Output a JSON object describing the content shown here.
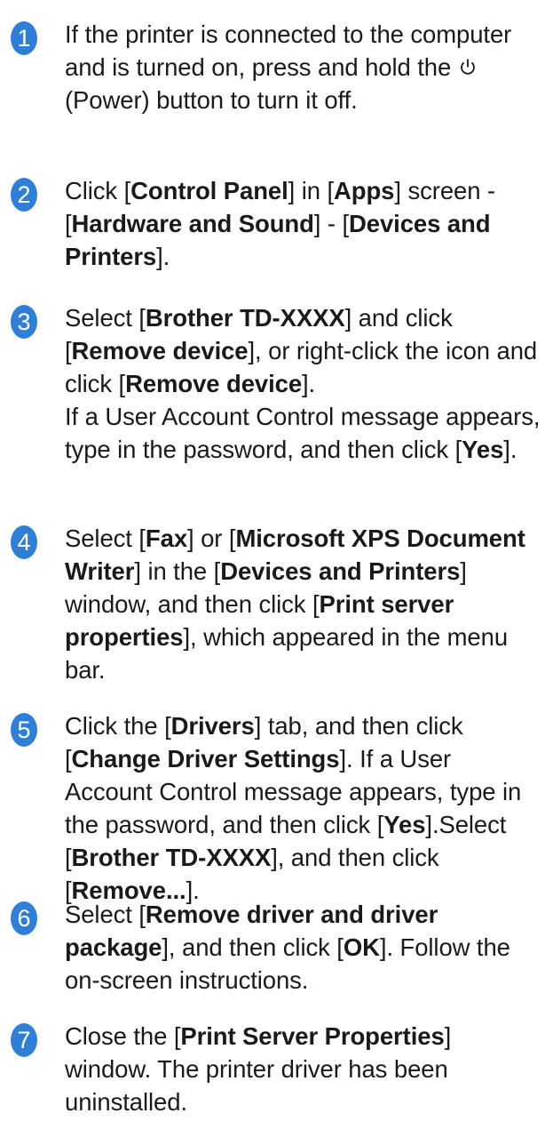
{
  "steps": [
    {
      "number": "1",
      "parts": [
        {
          "t": "If the printer is connected to the computer and is turned on, press and hold the "
        },
        {
          "icon": "power-icon"
        },
        {
          "t": " (Power) button to turn it off."
        }
      ]
    },
    {
      "number": "2",
      "parts": [
        {
          "t": "Click ["
        },
        {
          "b": "Control Panel"
        },
        {
          "t": "] in ["
        },
        {
          "b": "Apps"
        },
        {
          "t": "] screen - ["
        },
        {
          "b": "Hardware and Sound"
        },
        {
          "t": "] - ["
        },
        {
          "b": "Devices and Printers"
        },
        {
          "t": "]."
        }
      ]
    },
    {
      "number": "3",
      "parts": [
        {
          "t": "Select ["
        },
        {
          "b": "Brother TD-XXXX"
        },
        {
          "t": "] and click ["
        },
        {
          "b": "Remove device"
        },
        {
          "t": "], or right-click the icon and click ["
        },
        {
          "b": "Remove device"
        },
        {
          "t": "]."
        },
        {
          "br": true
        },
        {
          "t": "If a User Account Control message appears, type in the password, and then click ["
        },
        {
          "b": "Yes"
        },
        {
          "t": "]."
        }
      ]
    },
    {
      "number": "4",
      "parts": [
        {
          "t": "Select ["
        },
        {
          "b": "Fax"
        },
        {
          "t": "] or ["
        },
        {
          "b": "Microsoft XPS Document Writer"
        },
        {
          "t": "] in the ["
        },
        {
          "b": "Devices and Printers"
        },
        {
          "t": "] window, and then click ["
        },
        {
          "b": "Print server properties"
        },
        {
          "t": "], which appeared in the menu bar."
        }
      ]
    },
    {
      "number": "5",
      "parts": [
        {
          "t": "Click the ["
        },
        {
          "b": "Drivers"
        },
        {
          "t": "] tab, and then click ["
        },
        {
          "b": "Change Driver Settings"
        },
        {
          "t": "]. If a User Account Control message appears, type in the password, and then click ["
        },
        {
          "b": "Yes"
        },
        {
          "t": "].Select ["
        },
        {
          "b": "Brother TD-XXXX"
        },
        {
          "t": "], and then click ["
        },
        {
          "b": "Remove..."
        },
        {
          "t": "]."
        }
      ]
    },
    {
      "number": "6",
      "parts": [
        {
          "t": "Select ["
        },
        {
          "b": "Remove driver and driver package"
        },
        {
          "t": "], and then click ["
        },
        {
          "b": "OK"
        },
        {
          "t": "]. Follow the on-screen instructions."
        }
      ]
    },
    {
      "number": "7",
      "parts": [
        {
          "t": "Close the ["
        },
        {
          "b": "Print Server Properties"
        },
        {
          "t": "] window. The printer driver has been uninstalled."
        }
      ]
    }
  ],
  "colors": {
    "badge": "#2f7fd6",
    "text": "#1a1a1a"
  }
}
